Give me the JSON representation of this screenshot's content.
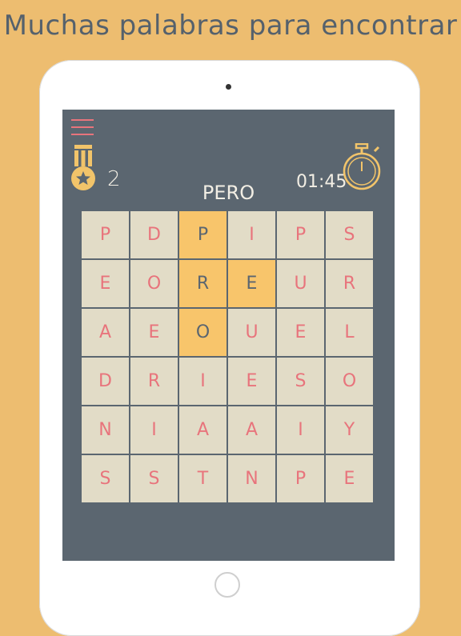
{
  "headline": "Muchas palabras para encontrar",
  "game": {
    "score": "2",
    "timer": "01:45",
    "target_word": "PERO"
  },
  "colors": {
    "background": "#EDBD70",
    "screen": "#5B6670",
    "cell": "#E2DCC7",
    "selected_cell": "#F8C56B",
    "letter": "#E8747C",
    "accent_icon": "#F2C46A"
  },
  "icons": {
    "menu": "hamburger-menu-icon",
    "medal": "medal-star-icon",
    "timer": "stopwatch-icon"
  },
  "grid": {
    "rows": [
      [
        {
          "letter": "P",
          "selected": false
        },
        {
          "letter": "D",
          "selected": false
        },
        {
          "letter": "P",
          "selected": true
        },
        {
          "letter": "I",
          "selected": false
        },
        {
          "letter": "P",
          "selected": false
        },
        {
          "letter": "S",
          "selected": false
        }
      ],
      [
        {
          "letter": "E",
          "selected": false
        },
        {
          "letter": "O",
          "selected": false
        },
        {
          "letter": "R",
          "selected": true
        },
        {
          "letter": "E",
          "selected": true
        },
        {
          "letter": "U",
          "selected": false
        },
        {
          "letter": "R",
          "selected": false
        }
      ],
      [
        {
          "letter": "A",
          "selected": false
        },
        {
          "letter": "E",
          "selected": false
        },
        {
          "letter": "O",
          "selected": true
        },
        {
          "letter": "U",
          "selected": false
        },
        {
          "letter": "E",
          "selected": false
        },
        {
          "letter": "L",
          "selected": false
        }
      ],
      [
        {
          "letter": "D",
          "selected": false
        },
        {
          "letter": "R",
          "selected": false
        },
        {
          "letter": "I",
          "selected": false
        },
        {
          "letter": "E",
          "selected": false
        },
        {
          "letter": "S",
          "selected": false
        },
        {
          "letter": "O",
          "selected": false
        }
      ],
      [
        {
          "letter": "N",
          "selected": false
        },
        {
          "letter": "I",
          "selected": false
        },
        {
          "letter": "A",
          "selected": false
        },
        {
          "letter": "A",
          "selected": false
        },
        {
          "letter": "I",
          "selected": false
        },
        {
          "letter": "Y",
          "selected": false
        }
      ],
      [
        {
          "letter": "S",
          "selected": false
        },
        {
          "letter": "S",
          "selected": false
        },
        {
          "letter": "T",
          "selected": false
        },
        {
          "letter": "N",
          "selected": false
        },
        {
          "letter": "P",
          "selected": false
        },
        {
          "letter": "E",
          "selected": false
        }
      ]
    ]
  }
}
